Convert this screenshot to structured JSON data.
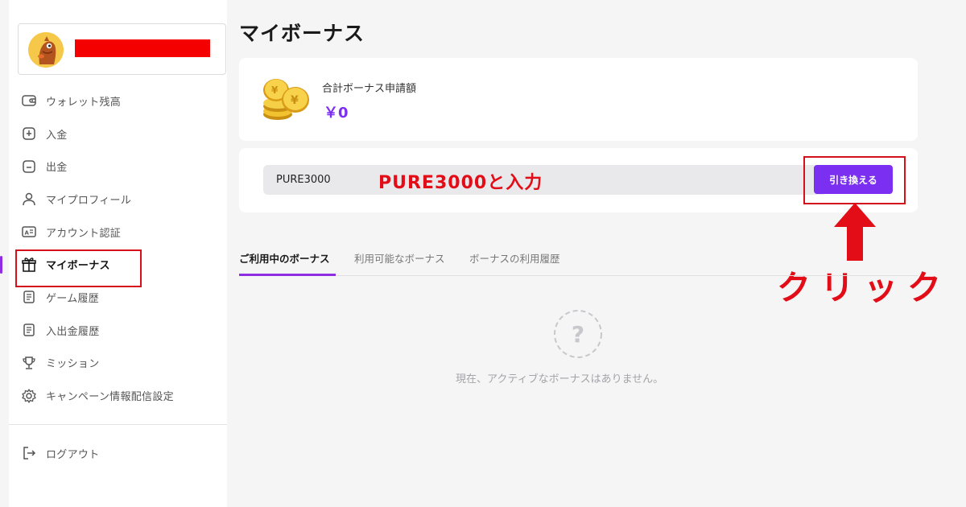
{
  "sidebar": {
    "menu": [
      {
        "label": "ウォレット残高",
        "icon": "wallet-icon"
      },
      {
        "label": "入金",
        "icon": "deposit-icon"
      },
      {
        "label": "出金",
        "icon": "withdraw-icon"
      },
      {
        "label": "マイプロフィール",
        "icon": "user-icon"
      },
      {
        "label": "アカウント認証",
        "icon": "id-card-icon"
      },
      {
        "label": "マイボーナス",
        "icon": "gift-icon",
        "active": true
      },
      {
        "label": "ゲーム履歴",
        "icon": "document-icon"
      },
      {
        "label": "入出金履歴",
        "icon": "document-icon"
      },
      {
        "label": "ミッション",
        "icon": "trophy-icon"
      },
      {
        "label": "キャンペーン情報配信設定",
        "icon": "gear-icon"
      }
    ],
    "logout_label": "ログアウト"
  },
  "main": {
    "title": "マイボーナス",
    "bonus_label": "合計ボーナス申請額",
    "bonus_amount": "￥0",
    "code_value": "PURE3000",
    "redeem_label": "引き換える",
    "tabs": [
      "ご利用中のボーナス",
      "利用可能なボーナス",
      "ボーナスの利用履歴"
    ],
    "empty_message": "現在、アクティブなボーナスはありません。"
  },
  "annotations": {
    "input_hint": "PURE3000と入力",
    "click_hint": "クリック"
  },
  "colors": {
    "accent": "#7b2ff0",
    "annotation_red": "#e30d18",
    "redaction": "#f40000"
  }
}
